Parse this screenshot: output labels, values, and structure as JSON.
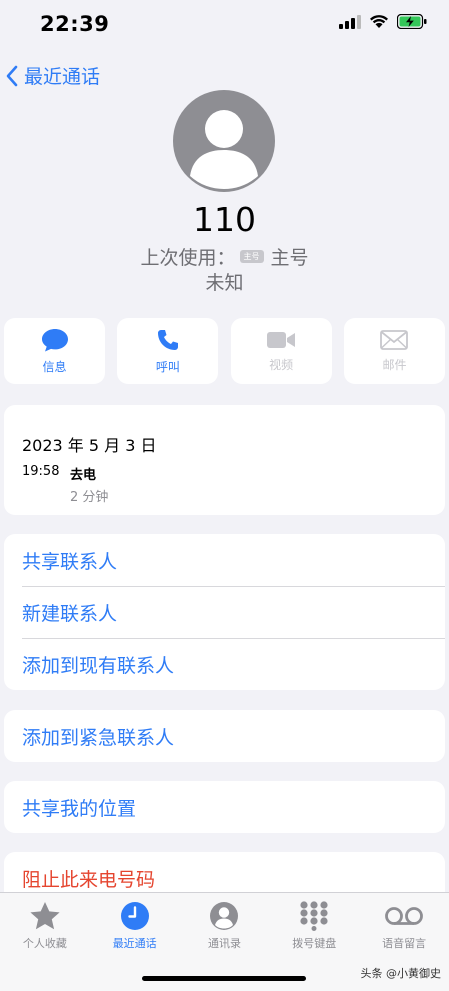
{
  "status": {
    "time": "22:39"
  },
  "nav": {
    "back_label": "最近通话"
  },
  "contact": {
    "number": "110",
    "last_used_label": "上次使用：",
    "sim_badge": "主号",
    "sim_name": "主号",
    "location": "未知"
  },
  "actions": [
    {
      "label": "信息",
      "enabled": true
    },
    {
      "label": "呼叫",
      "enabled": true
    },
    {
      "label": "视频",
      "enabled": false
    },
    {
      "label": "邮件",
      "enabled": false
    }
  ],
  "call_log": {
    "date": "2023 年 5 月 3 日",
    "time": "19:58",
    "type": "去电",
    "duration": "2 分钟"
  },
  "options": {
    "share_contact": "共享联系人",
    "new_contact": "新建联系人",
    "add_existing": "添加到现有联系人",
    "add_emergency": "添加到紧急联系人",
    "share_location": "共享我的位置",
    "block": "阻止此来电号码"
  },
  "tabs": [
    {
      "label": "个人收藏",
      "active": false
    },
    {
      "label": "最近通话",
      "active": true
    },
    {
      "label": "通讯录",
      "active": false
    },
    {
      "label": "拨号键盘",
      "active": false
    },
    {
      "label": "语音留言",
      "active": false
    }
  ],
  "watermark": "头条 @小黄御史",
  "colors": {
    "accent": "#2f7cf6",
    "danger": "#e5452f",
    "battery": "#34c759"
  }
}
